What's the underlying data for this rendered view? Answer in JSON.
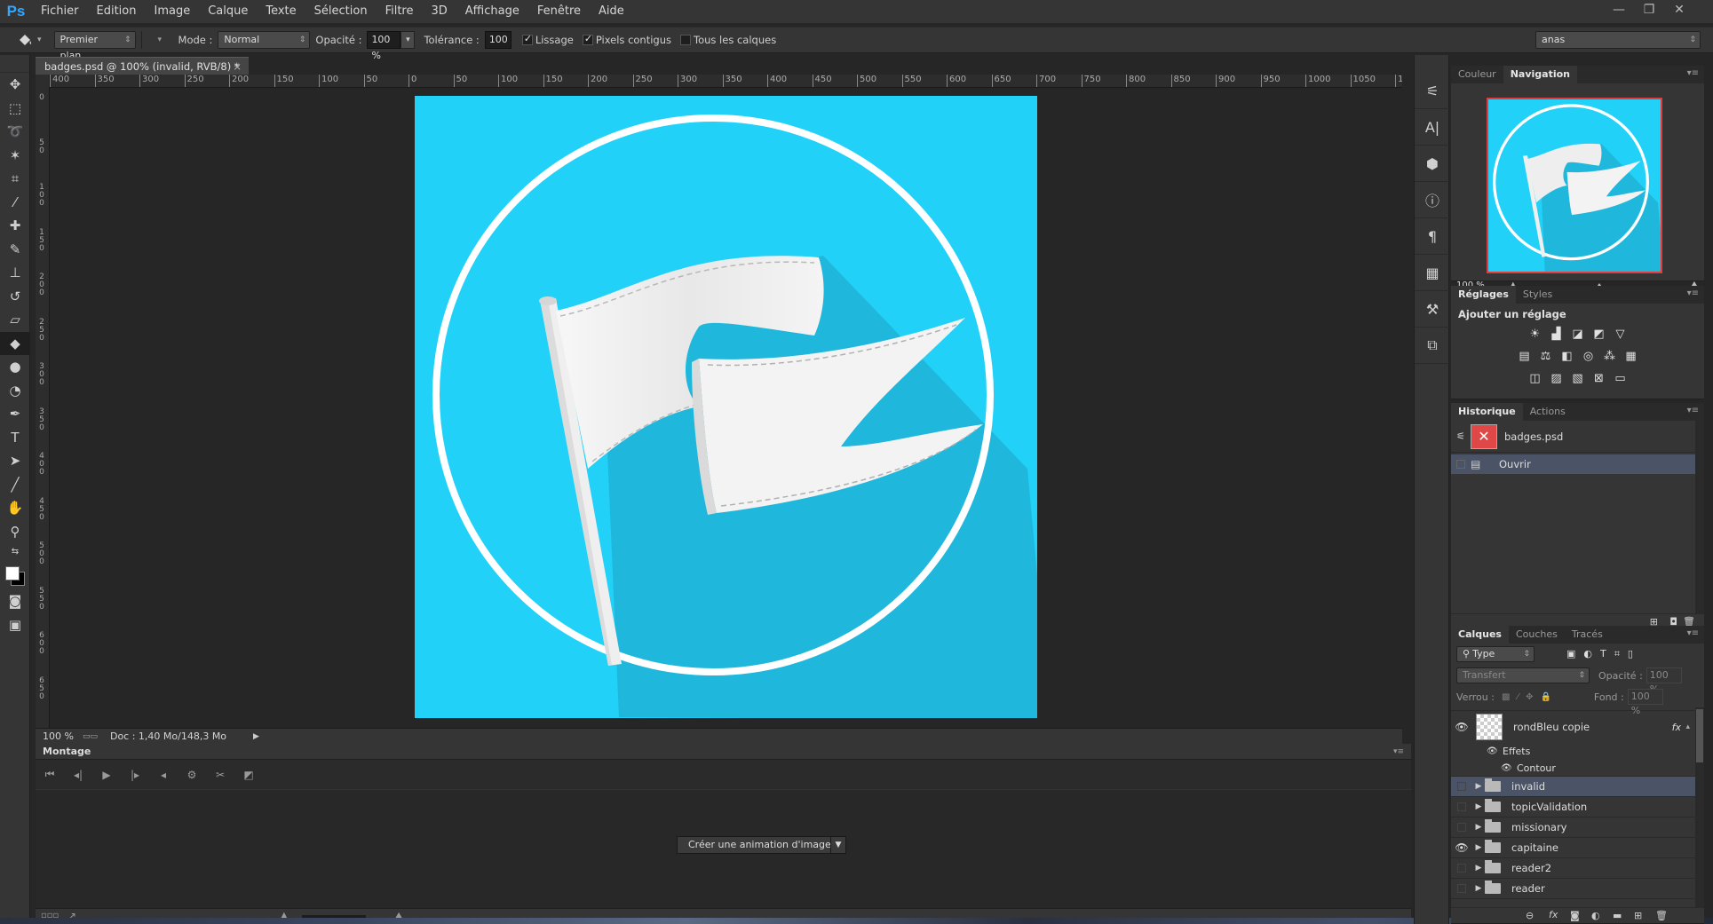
{
  "app": {
    "logo": "Ps"
  },
  "menu": [
    "Fichier",
    "Edition",
    "Image",
    "Calque",
    "Texte",
    "Sélection",
    "Filtre",
    "3D",
    "Affichage",
    "Fenêtre",
    "Aide"
  ],
  "window_controls": {
    "minimize": "—",
    "restore": "❐",
    "close": "✕"
  },
  "options": {
    "tool_icon": "paint-bucket-icon",
    "source": "Premier plan",
    "mode_label": "Mode :",
    "mode_value": "Normal",
    "opacity_label": "Opacité :",
    "opacity_value": "100 %",
    "tolerance_label": "Tolérance :",
    "tolerance_value": "100",
    "lissage": "Lissage",
    "pixels_contigus": "Pixels contigus",
    "tous_calques": "Tous les calques",
    "workspace": "anas"
  },
  "document": {
    "tab_title": "badges.psd @ 100% (invalid, RVB/8) *",
    "tab_close": "×",
    "ruler_top": [
      "400",
      "350",
      "300",
      "250",
      "200",
      "150",
      "100",
      "50",
      "0",
      "50",
      "100",
      "150",
      "200",
      "250",
      "300",
      "350",
      "400",
      "450",
      "500",
      "550",
      "600",
      "650",
      "700",
      "750",
      "800",
      "850",
      "900",
      "950",
      "1000",
      "1050",
      "1"
    ],
    "ruler_left": [
      "0",
      "5 0",
      "1 0 0",
      "1 5 0",
      "2 0 0",
      "2 5 0",
      "3 0 0",
      "3 5 0",
      "4 0 0",
      "4 5 0",
      "5 0 0",
      "5 5 0",
      "6 0 0",
      "6 5 0"
    ],
    "canvas_bg": "#22d1f7",
    "shadow_color": "#1fb8dc",
    "ring_color": "#ffffff",
    "flag_color": "#f2f2f2"
  },
  "status": {
    "zoom": "100 %",
    "doc": "Doc : 1,40 Mo/148,3 Mo"
  },
  "timeline": {
    "title": "Montage",
    "create_button": "Créer une animation d'image",
    "controls": [
      "first-frame-icon",
      "prev-frame-icon",
      "play-icon",
      "next-frame-icon",
      "audio-icon",
      "settings-icon",
      "scissors-icon",
      "transition-icon"
    ]
  },
  "dock_icons": [
    "history-brush-icon",
    "character-icon",
    "3d-icon",
    "info-icon",
    "paragraph-icon",
    "swatches-icon",
    "tool-presets-icon",
    "layer-comps-icon"
  ],
  "navigation_panel": {
    "tabs": [
      "Couleur",
      "Navigation"
    ],
    "active_tab": "Navigation",
    "zoom": "100 %"
  },
  "adjustments_panel": {
    "tabs": [
      "Réglages",
      "Styles"
    ],
    "active_tab": "Réglages",
    "heading": "Ajouter un réglage"
  },
  "history_panel": {
    "tabs": [
      "Historique",
      "Actions"
    ],
    "active_tab": "Historique",
    "snapshot": "badges.psd",
    "items": [
      "Ouvrir"
    ]
  },
  "layers_panel": {
    "tabs": [
      "Calques",
      "Couches",
      "Tracés"
    ],
    "active_tab": "Calques",
    "filter": "Type",
    "blend_mode": "Transfert",
    "opacity_label": "Opacité :",
    "opacity_value": "100 %",
    "lock_label": "Verrou :",
    "fill_label": "Fond :",
    "fill_value": "100 %",
    "layer_top": {
      "name": "rondBleu copie",
      "fx": "fx",
      "effects_label": "Effets",
      "effect": "Contour"
    },
    "groups": [
      {
        "name": "invalid",
        "visible": false,
        "selected": true
      },
      {
        "name": "topicValidation",
        "visible": false,
        "selected": false
      },
      {
        "name": "missionary",
        "visible": false,
        "selected": false
      },
      {
        "name": "capitaine",
        "visible": true,
        "selected": false
      },
      {
        "name": "reader2",
        "visible": false,
        "selected": false
      },
      {
        "name": "reader",
        "visible": false,
        "selected": false
      }
    ],
    "footer_fx": "fx"
  }
}
